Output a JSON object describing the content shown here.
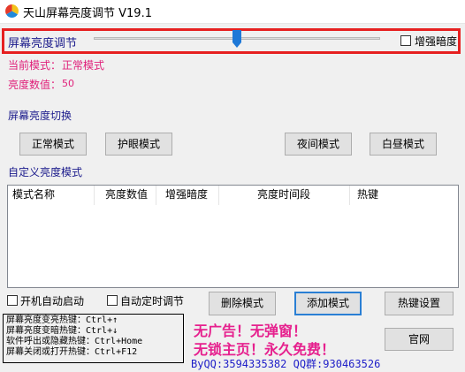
{
  "window": {
    "title": "天山屏幕亮度调节 V19.1"
  },
  "brightness": {
    "label": "屏幕亮度调节",
    "slider_level": 0.5,
    "enhance_label": "增强暗度",
    "enhance_checked": false
  },
  "status": {
    "current_mode_label": "当前模式：",
    "current_mode_value": "正常模式",
    "brightness_value_label": "亮度数值：",
    "brightness_value": "50"
  },
  "mode_switch": {
    "label": "屏幕亮度切换",
    "buttons": [
      "正常模式",
      "护眼模式",
      "夜间模式",
      "白昼模式"
    ]
  },
  "custom": {
    "label": "自定义亮度模式",
    "columns": [
      "模式名称",
      "亮度数值",
      "增强暗度",
      "亮度时间段",
      "热键"
    ],
    "rows": []
  },
  "options": {
    "autostart_label": "开机自动启动",
    "timer_label": "自动定时调节",
    "delete_label": "删除模式",
    "add_label": "添加模式",
    "hotkey_settings_label": "热键设置"
  },
  "hotkeys": {
    "line1": "屏幕亮度变亮热键：Ctrl+↑",
    "line2": "屏幕亮度变暗热键：Ctrl+↓",
    "line3": "软件呼出或隐藏热键：Ctrl+Home",
    "line4": "屏幕关闭或打开热键：Ctrl+F12"
  },
  "promo": {
    "line1": "无广告！无弹窗！",
    "line2": "无锁主页！永久免费！",
    "contact": "ByQQ:3594335382 QQ群:930463526",
    "website_label": "官网"
  },
  "colors": {
    "highlight_border": "#e62020",
    "section_text": "#1b1b8c",
    "status_text": "#e0207a",
    "promo_text": "#e6218e",
    "contact_text": "#1e1ec8",
    "slider_thumb": "#1e78d7",
    "focus_button_border": "#2a7fd4"
  },
  "icons": {
    "app": "app-icon-tricolor-circle",
    "slider": "slider-thumb"
  }
}
